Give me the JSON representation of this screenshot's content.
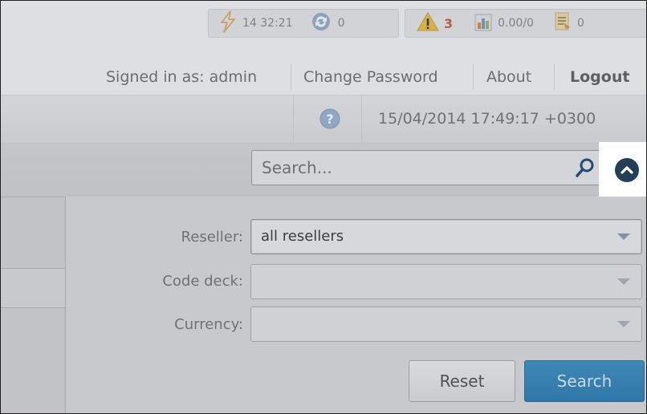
{
  "status": {
    "uptime": "14 32:21",
    "sync_count": "0",
    "alerts": "3",
    "billing": "0.00/0",
    "jobs": "0"
  },
  "user": {
    "signed_in": "Signed in as: admin",
    "change_password": "Change Password",
    "about": "About",
    "logout": "Logout"
  },
  "clock": "15/04/2014 17:49:17 +0300",
  "search": {
    "placeholder": "Search..."
  },
  "filters": {
    "reseller_label": "Reseller:",
    "reseller_value": "all resellers",
    "code_deck_label": "Code deck:",
    "code_deck_value": "",
    "currency_label": "Currency:",
    "currency_value": ""
  },
  "buttons": {
    "reset": "Reset",
    "search": "Search"
  },
  "colors": {
    "primary": "#2f77a6",
    "alert": "#b85f4d",
    "collapse": "#233e57"
  }
}
